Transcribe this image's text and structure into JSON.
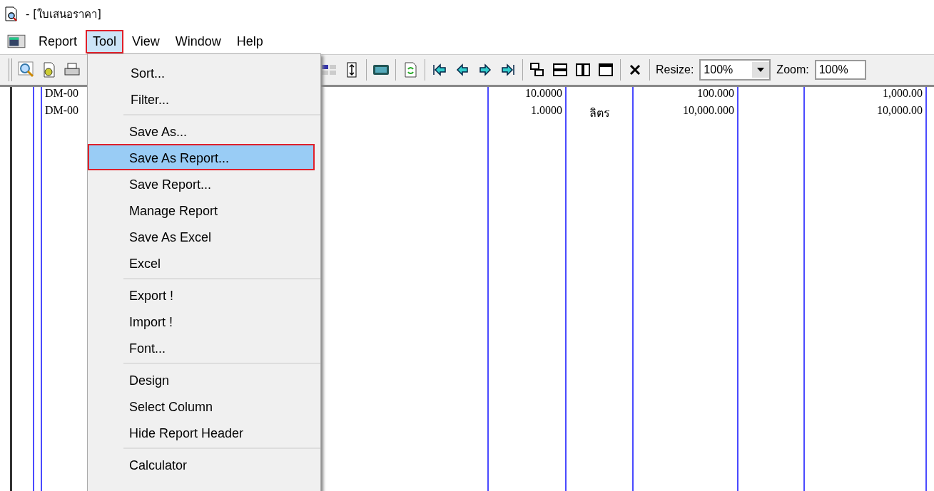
{
  "window": {
    "title": "- [ใบเสนอราคา]"
  },
  "menubar": [
    {
      "label": "Report",
      "selected": false
    },
    {
      "label": "Tool",
      "selected": true
    },
    {
      "label": "View",
      "selected": false
    },
    {
      "label": "Window",
      "selected": false
    },
    {
      "label": "Help",
      "selected": false
    }
  ],
  "toolbar": {
    "resize": {
      "label": "Resize:",
      "value": "100%"
    },
    "zoom": {
      "label": "Zoom:",
      "value": "100%"
    }
  },
  "table": {
    "rows": [
      {
        "code": "DM-00",
        "qty": "10.0000",
        "unit": "",
        "price": "100.000",
        "total": "1,000.00"
      },
      {
        "code": "DM-00",
        "qty": "1.0000",
        "unit": "ลิตร",
        "price": "10,000.000",
        "total": "10,000.00"
      }
    ]
  },
  "tool_menu": {
    "groups": [
      [
        {
          "label": "Sort...",
          "selected": false
        },
        {
          "label": "Filter...",
          "selected": false
        }
      ],
      [
        {
          "label": "Save As...",
          "selected": false
        },
        {
          "label": "Save As Report...",
          "selected": true
        },
        {
          "label": "Save Report...",
          "selected": false
        },
        {
          "label": "Manage Report",
          "selected": false
        },
        {
          "label": "Save As Excel",
          "selected": false
        },
        {
          "label": "Excel",
          "selected": false
        }
      ],
      [
        {
          "label": "Export !",
          "selected": false
        },
        {
          "label": "Import !",
          "selected": false
        },
        {
          "label": "Font...",
          "selected": false
        }
      ],
      [
        {
          "label": "Design",
          "selected": false
        },
        {
          "label": "Select Column",
          "selected": false
        },
        {
          "label": "Hide Report Header",
          "selected": false
        }
      ],
      [
        {
          "label": "Calculator",
          "selected": false
        }
      ]
    ]
  }
}
